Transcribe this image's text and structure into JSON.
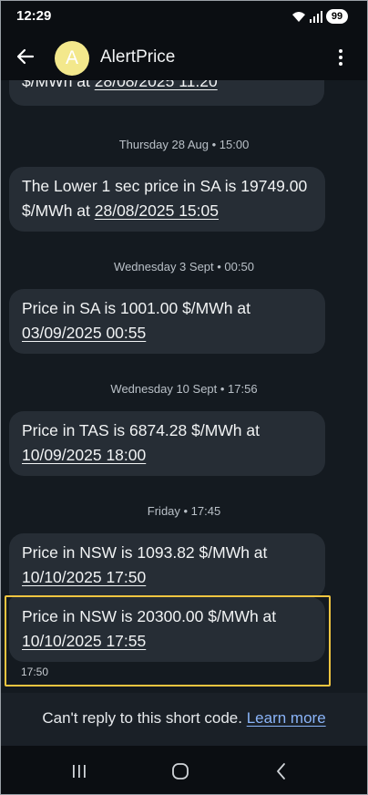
{
  "status": {
    "time": "12:29",
    "battery": "99"
  },
  "header": {
    "avatar_letter": "A",
    "title": "AlertPrice"
  },
  "messages": [
    {
      "kind": "partial",
      "text": "$/MWh at ",
      "link": "28/08/2025 11:20"
    },
    {
      "kind": "timestamp",
      "text": "Thursday 28 Aug • 15:00"
    },
    {
      "kind": "message",
      "line1": "The Lower 1 sec price in SA is 19749.00",
      "line2_prefix": "$/MWh at ",
      "link": "28/08/2025 15:05"
    },
    {
      "kind": "timestamp",
      "text": "Wednesday 3 Sept • 00:50"
    },
    {
      "kind": "message",
      "line1": "Price in SA is 1001.00 $/MWh at",
      "link": "03/09/2025 00:55"
    },
    {
      "kind": "timestamp",
      "text": "Wednesday 10 Sept • 17:56"
    },
    {
      "kind": "message",
      "line1": "Price in TAS is 6874.28 $/MWh at",
      "link": "10/09/2025 18:00"
    },
    {
      "kind": "timestamp",
      "text": "Friday • 17:45"
    },
    {
      "kind": "message",
      "line1": "Price in NSW is 1093.82 $/MWh at",
      "link": "10/10/2025 17:50"
    },
    {
      "kind": "message",
      "line1": "Price in NSW is 20300.00 $/MWh at",
      "link": "10/10/2025 17:55",
      "sent_time": "17:50",
      "highlighted": true
    }
  ],
  "footer": {
    "text": "Can't reply to this short code.",
    "link": "Learn more"
  },
  "colors": {
    "highlight": "#f2c540",
    "bubble": "#262d35",
    "link": "#8ab4f8",
    "avatar": "#f3e88c"
  }
}
